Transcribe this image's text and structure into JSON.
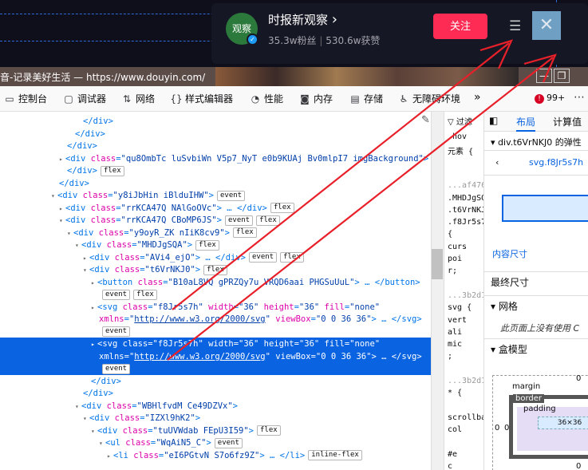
{
  "overlay": {
    "account_name": "时报新观察",
    "avatar_text": "观察",
    "followers": "35.3w粉丝",
    "likes": "530.6w获赞",
    "follow_label": "关注",
    "close_glyph": "✕",
    "chevron": "›"
  },
  "window": {
    "title": "音-记录美好生活 — https://www.douyin.com/"
  },
  "devtools": {
    "tabs": [
      "控制台",
      "调试器",
      "网络",
      "样式编辑器",
      "性能",
      "内存",
      "存储",
      "无障碍环境"
    ],
    "error_count": "99+"
  },
  "markup": {
    "lines": [
      {
        "indent": 104,
        "tri": "",
        "html": "</div>",
        "badges": []
      },
      {
        "indent": 94,
        "tri": "",
        "html": "</div>",
        "badges": []
      },
      {
        "indent": 84,
        "tri": "",
        "html": "</div>",
        "badges": []
      },
      {
        "indent": 74,
        "tri": "▸",
        "html": "<div class=\"qu8OmbTc luSvbiWn V5p7_NyT e0b9KUAj Bv0mlpI7 imgBackground\">",
        "badges": []
      },
      {
        "indent": 84,
        "tri": "",
        "html": "</div>",
        "badges": [
          "flex"
        ]
      },
      {
        "indent": 74,
        "tri": "",
        "html": "</div>",
        "badges": []
      },
      {
        "indent": 64,
        "tri": "▾",
        "html": "<div class=\"y8iJbHin iBlduIHW\">",
        "badges": [
          "event"
        ]
      },
      {
        "indent": 74,
        "tri": "▸",
        "html": "<div class=\"rrKCA47Q NAlGoOVc\"> … </div>",
        "badges": [
          "flex"
        ]
      },
      {
        "indent": 74,
        "tri": "▾",
        "html": "<div class=\"rrKCA47Q CBoMP6JS\">",
        "badges": [
          "event",
          "flex"
        ]
      },
      {
        "indent": 84,
        "tri": "▾",
        "html": "<div class=\"y9oyR_ZK nIiK8cv9\">",
        "badges": [
          "flex"
        ]
      },
      {
        "indent": 94,
        "tri": "▾",
        "html": "<div class=\"MHDJgSQA\">",
        "badges": [
          "flex"
        ]
      },
      {
        "indent": 104,
        "tri": "▸",
        "html": "<div class=\"AVi4_ejO\"> … </div>",
        "badges": [
          "event",
          "flex"
        ]
      },
      {
        "indent": 104,
        "tri": "▾",
        "html": "<div class=\"t6VrNKJ0\">",
        "badges": [
          "flex"
        ]
      },
      {
        "indent": 114,
        "tri": "▸",
        "html": "<button class=\"B10aL8VQ gPRZQy7u VRQD6aai PHGSuUuL\"> … </button>",
        "badges": []
      },
      {
        "indent": 124,
        "tri": "",
        "html": "",
        "badges": [
          "event",
          "flex"
        ]
      },
      {
        "indent": 114,
        "tri": "▸",
        "html": "<svg class=\"f8Jr5s7h\" width=\"36\" height=\"36\" fill=\"none\"",
        "badges": []
      },
      {
        "indent": 124,
        "tri": "",
        "html": "xmlns=\"http://www.w3.org/2000/svg\" viewBox=\"0 0 36 36\"> … </svg>",
        "badges": []
      },
      {
        "indent": 124,
        "tri": "",
        "html": "",
        "badges": [
          "event"
        ]
      },
      {
        "indent": 114,
        "tri": "▸",
        "html": "<svg class=\"f8Jr5s7h\" width=\"36\" height=\"36\" fill=\"none\"",
        "badges": []
      },
      {
        "indent": 124,
        "tri": "",
        "html": "xmlns=\"http://www.w3.org/2000/svg\" viewBox=\"0 0 36 36\"> … </svg>",
        "badges": []
      },
      {
        "indent": 124,
        "tri": "",
        "html": "",
        "badges": [
          "event"
        ]
      },
      {
        "indent": 114,
        "tri": "",
        "html": "</div>",
        "badges": []
      },
      {
        "indent": 104,
        "tri": "",
        "html": "</div>",
        "badges": []
      },
      {
        "indent": 94,
        "tri": "▾",
        "html": "<div class=\"WBHlfvdM Ce49DZVx\">",
        "badges": []
      },
      {
        "indent": 104,
        "tri": "▾",
        "html": "<div class=\"IZXl9hK2\">",
        "badges": []
      },
      {
        "indent": 114,
        "tri": "▾",
        "html": "<div class=\"tuUVWdab FEpU3I59\">",
        "badges": [
          "flex"
        ]
      },
      {
        "indent": 124,
        "tri": "▾",
        "html": "<ul class=\"WqAiN5_C\">",
        "badges": [
          "event"
        ]
      },
      {
        "indent": 134,
        "tri": "▸",
        "html": "<li class=\"eI6PGtvN S7o6fz9Z\"> … </li>",
        "badges": [
          "inline-flex"
        ]
      }
    ],
    "selected_index": 18
  },
  "rules": {
    "filter_label": "过滤",
    "lines": [
      ".hov",
      "元素 {",
      "",
      "",
      "...af476.",
      ".MHDJgSQ",
      ".t6VrNKJ",
      ".f8Jr5s7",
      "{",
      "  curs",
      "  poi",
      "  r;",
      "",
      "...3b2d1.",
      "svg {",
      "  vert",
      "  ali",
      "  mic",
      "  ;",
      "",
      "...3b2d1.",
      "* {",
      "",
      "scrollba",
      "  col",
      "",
      "#e",
      "  c",
      "  tr"
    ]
  },
  "layout": {
    "tab_layout": "布局",
    "tab_computed": "计算值",
    "flex_container": "div.t6VrNKJ0 的弹性",
    "flex_item": "svg.f8Jr5s7h",
    "content_size_label": "内容尺寸",
    "final_size_label": "最终尺寸",
    "grid_section": "网格",
    "grid_empty": "此页面上没有使用 C",
    "box_model_section": "盒模型",
    "bm_margin": "margin",
    "bm_border": "border",
    "bm_padding": "padding",
    "bm_content": "36×36",
    "bm_zero": "0"
  },
  "colors": {
    "follow_button": "#fe2c55",
    "selection": "#0a63e0",
    "annotation_arrow": "#e8202a"
  }
}
